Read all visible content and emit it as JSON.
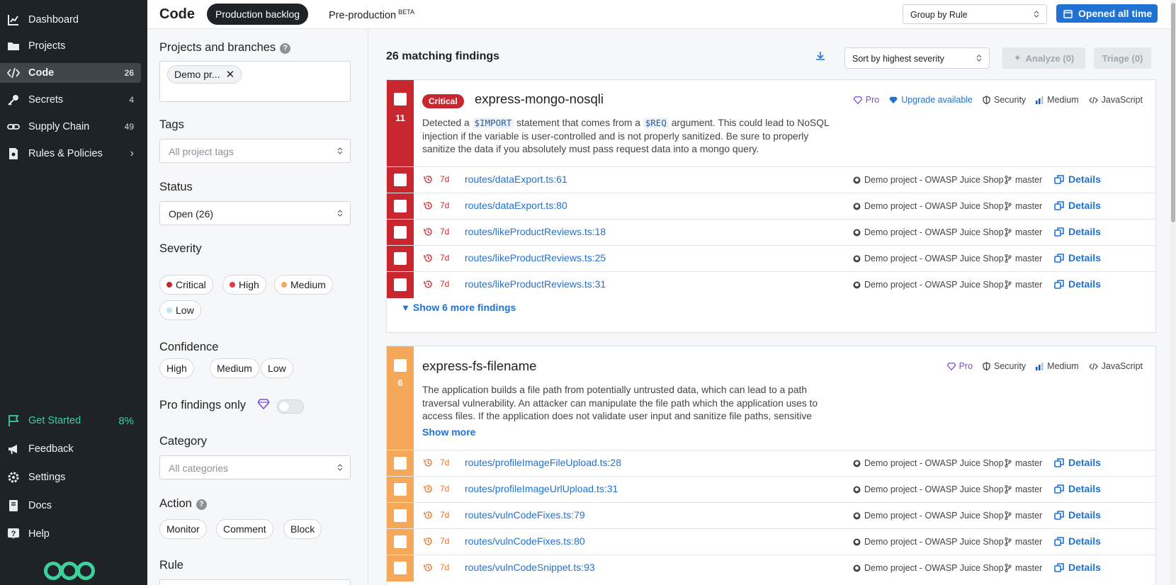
{
  "colors": {
    "sidebar_bg": "#1d2326",
    "accent": "#1f72d3",
    "critical": "#c9272f",
    "high": "#f5a85a",
    "green": "#3ed09a"
  },
  "sidebar": {
    "items": [
      {
        "label": "Dashboard",
        "icon": "chart-icon",
        "count": ""
      },
      {
        "label": "Projects",
        "icon": "folder-icon",
        "count": ""
      },
      {
        "label": "Code",
        "icon": "code-icon",
        "count": "26",
        "active": true
      },
      {
        "label": "Secrets",
        "icon": "key-icon",
        "count": "4"
      },
      {
        "label": "Supply Chain",
        "icon": "link-icon",
        "count": "49"
      },
      {
        "label": "Rules & Policies",
        "icon": "policy-icon",
        "count": ""
      }
    ],
    "bottom": [
      {
        "label": "Get Started",
        "icon": "flag-icon",
        "count": "8%"
      },
      {
        "label": "Feedback",
        "icon": "megaphone-icon"
      },
      {
        "label": "Settings",
        "icon": "gear-icon"
      },
      {
        "label": "Docs",
        "icon": "book-icon"
      },
      {
        "label": "Help",
        "icon": "help-icon"
      }
    ]
  },
  "header": {
    "title": "Code",
    "tab_active": "Production backlog",
    "tab_other": "Pre-production",
    "tab_other_badge": "BETA",
    "group_by": "Group by Rule",
    "opened": "Opened all time"
  },
  "filters": {
    "projects_label": "Projects and branches",
    "projects_help": "?",
    "project_chip": "Demo pr...",
    "tags_label": "Tags",
    "tags_placeholder": "All project tags",
    "status_label": "Status",
    "status_value": "Open (26)",
    "severity_label": "Severity",
    "severity": [
      "Critical",
      "High",
      "Medium",
      "Low"
    ],
    "confidence_label": "Confidence",
    "confidence": [
      "High",
      "Medium",
      "Low"
    ],
    "pro_label": "Pro findings only",
    "pro_enabled": false,
    "category_label": "Category",
    "category_placeholder": "All categories",
    "action_label": "Action",
    "action_help": "?",
    "actions": [
      "Monitor",
      "Comment",
      "Block"
    ],
    "rule_label": "Rule"
  },
  "main": {
    "count": "26 matching findings",
    "sort": "Sort by highest severity",
    "analyze": "Analyze (0)",
    "triage": "Triage (0)"
  },
  "groups": [
    {
      "severity": "Critical",
      "count": "11",
      "rule": "express-mongo-nosqli",
      "pro": "Pro",
      "upgrade": "Upgrade available",
      "category": "Security",
      "confidence": "Medium",
      "language": "JavaScript",
      "desc_a": "Detected a ",
      "code1": "$IMPORT",
      "desc_b": " statement that comes from a ",
      "code2": "$REQ",
      "desc_c": " argument. This could lead to NoSQL injection if the variable is user-controlled and is not properly sanitized. Be sure to properly sanitize the data if you absolutely must pass request data into a mongo query.",
      "show_more_findings": "Show 6 more findings",
      "findings": [
        {
          "age": "7d",
          "path": "routes/dataExport.ts:61",
          "project": "Demo project - OWASP Juice Shop",
          "branch": "master",
          "details": "Details"
        },
        {
          "age": "7d",
          "path": "routes/dataExport.ts:80",
          "project": "Demo project - OWASP Juice Shop",
          "branch": "master",
          "details": "Details"
        },
        {
          "age": "7d",
          "path": "routes/likeProductReviews.ts:18",
          "project": "Demo project - OWASP Juice Shop",
          "branch": "master",
          "details": "Details"
        },
        {
          "age": "7d",
          "path": "routes/likeProductReviews.ts:25",
          "project": "Demo project - OWASP Juice Shop",
          "branch": "master",
          "details": "Details"
        },
        {
          "age": "7d",
          "path": "routes/likeProductReviews.ts:31",
          "project": "Demo project - OWASP Juice Shop",
          "branch": "master",
          "details": "Details"
        }
      ]
    },
    {
      "severity": "High",
      "count": "6",
      "rule": "express-fs-filename",
      "pro": "Pro",
      "category": "Security",
      "confidence": "Medium",
      "language": "JavaScript",
      "desc": "The application builds a file path from potentially untrusted data, which can lead to a path traversal vulnerability. An attacker can manipulate the file path which the application uses to access files. If the application does not validate user input and sanitize file paths, sensitive",
      "show_more": "Show more",
      "findings": [
        {
          "age": "7d",
          "path": "routes/profileImageFileUpload.ts:28",
          "project": "Demo project - OWASP Juice Shop",
          "branch": "master",
          "details": "Details"
        },
        {
          "age": "7d",
          "path": "routes/profileImageUrlUpload.ts:31",
          "project": "Demo project - OWASP Juice Shop",
          "branch": "master",
          "details": "Details"
        },
        {
          "age": "7d",
          "path": "routes/vulnCodeFixes.ts:79",
          "project": "Demo project - OWASP Juice Shop",
          "branch": "master",
          "details": "Details"
        },
        {
          "age": "7d",
          "path": "routes/vulnCodeFixes.ts:80",
          "project": "Demo project - OWASP Juice Shop",
          "branch": "master",
          "details": "Details"
        },
        {
          "age": "7d",
          "path": "routes/vulnCodeSnippet.ts:93",
          "project": "Demo project - OWASP Juice Shop",
          "branch": "master",
          "details": "Details"
        }
      ]
    }
  ]
}
